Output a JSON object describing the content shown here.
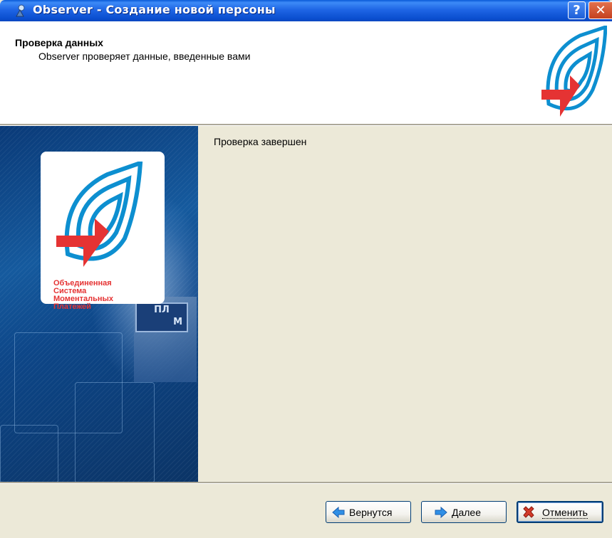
{
  "window": {
    "title": "Observer - Создание новой персоны",
    "help_glyph": "?",
    "close_glyph": "✕",
    "icons": [
      "observer-app-icon",
      "help-icon",
      "close-icon"
    ]
  },
  "header": {
    "title": "Проверка данных",
    "subtitle": "Observer проверяет данные, введенные вами"
  },
  "banner": {
    "logo_lines": [
      "Объединенная",
      "Система",
      "Моментальных",
      "Платежей"
    ],
    "terminal_screen_text": [
      "ПЛ",
      "М"
    ]
  },
  "content": {
    "status_text": "Проверка завершен"
  },
  "buttons": {
    "back_label": "Вернутся",
    "next_label": "Далее",
    "cancel_label": "Отменить"
  },
  "colors": {
    "titlebar": "#0b4fd0",
    "logo_blue": "#0d8fd0",
    "logo_red": "#e53333",
    "dialog_bg": "#ece9d8"
  }
}
